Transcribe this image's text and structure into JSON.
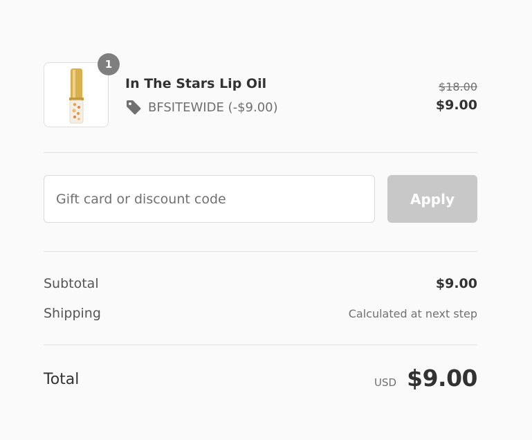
{
  "product": {
    "quantity": "1",
    "name": "In The Stars Lip Oil",
    "discount": "BFSITEWIDE (-$9.00)",
    "original_price": "$18.00",
    "price": "$9.00",
    "image": "lip-oil-bottle"
  },
  "discount_form": {
    "placeholder": "Gift card or discount code",
    "apply_label": "Apply"
  },
  "costs": {
    "subtotal_label": "Subtotal",
    "subtotal_value": "$9.00",
    "shipping_label": "Shipping",
    "shipping_value": "Calculated at next step",
    "total_label": "Total",
    "currency": "USD",
    "total_value": "$9.00"
  },
  "icons": {
    "tag": "tag-icon"
  },
  "colors": {
    "background": "#fafafa",
    "badge": "#7f7f7f",
    "apply_disabled": "#c8c8c8",
    "divider": "#e1e1e1"
  }
}
